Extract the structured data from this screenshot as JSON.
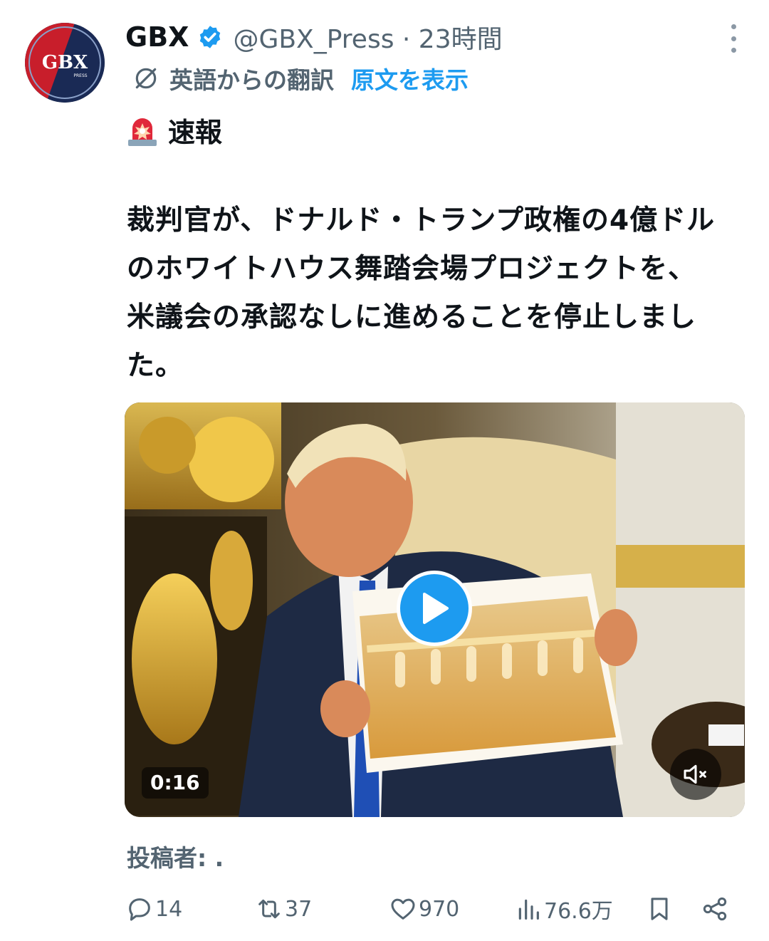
{
  "tweet": {
    "author_name": "GBX",
    "handle_time": "@GBX_Press · 23時間",
    "avatar_text": "GBX",
    "avatar_subtext": "PRESS",
    "translation_label": "英語からの翻訳",
    "show_original": "原文を表示",
    "breaking_label": "速報",
    "body_lines": [
      "裁判官が、ドナルド・トランプ政権の4億ドル",
      "のホワイトハウス舞踏会場プロジェクトを、",
      "米議会の承認なしに進めることを停止しまし",
      "た。"
    ],
    "video_duration": "0:16",
    "posted_by": "投稿者: ."
  },
  "actions": {
    "replies": "14",
    "reposts": "37",
    "likes": "970",
    "views": "76.6万"
  },
  "colors": {
    "accent": "#1d9bf0",
    "secondary_text": "#536471",
    "primary_text": "#0f1419"
  },
  "icons": [
    "verified-badge-icon",
    "more-icon",
    "translate-icon",
    "siren-icon",
    "play-icon",
    "mute-icon",
    "reply-icon",
    "repost-icon",
    "like-icon",
    "views-icon",
    "bookmark-icon",
    "share-icon"
  ]
}
